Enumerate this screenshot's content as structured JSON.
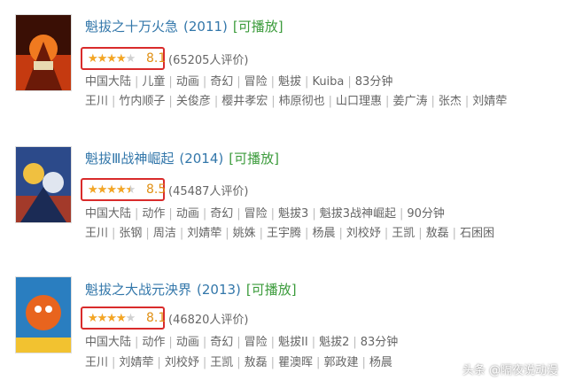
{
  "movies": [
    {
      "title": "魁拔之十万火急",
      "year": "(2011)",
      "playable": "[可播放]",
      "rating": 8.1,
      "score_text": "8.1",
      "stars_fraction": 0.8,
      "votes": "(65205人评价)",
      "tags": [
        "中国大陆",
        "儿童",
        "动画",
        "奇幻",
        "冒险",
        "魁拔",
        "Kuiba",
        "83分钟"
      ],
      "cast": [
        "王川",
        "竹内顺子",
        "关俊彦",
        "樱井孝宏",
        "柿原彻也",
        "山口理惠",
        "姜广涛",
        "张杰",
        "刘婧荦"
      ]
    },
    {
      "title": "魁拔Ⅲ战神崛起",
      "year": "(2014)",
      "playable": "[可播放]",
      "rating": 8.5,
      "score_text": "8.5",
      "stars_fraction": 0.9,
      "votes": "(45487人评价)",
      "tags": [
        "中国大陆",
        "动作",
        "动画",
        "奇幻",
        "冒险",
        "魁拔3",
        "魁拔3战神崛起",
        "90分钟"
      ],
      "cast": [
        "王川",
        "张钢",
        "周洁",
        "刘婧荦",
        "姚姝",
        "王宇腾",
        "杨晨",
        "刘校妤",
        "王凯",
        "敖磊",
        "石困困"
      ]
    },
    {
      "title": "魁拔之大战元泱界",
      "year": "(2013)",
      "playable": "[可播放]",
      "rating": 8.1,
      "score_text": "8.1",
      "stars_fraction": 0.8,
      "votes": "(46820人评价)",
      "tags": [
        "中国大陆",
        "动作",
        "动画",
        "奇幻",
        "冒险",
        "魁拔II",
        "魁拔2",
        "83分钟"
      ],
      "cast": [
        "王川",
        "刘婧荦",
        "刘校妤",
        "王凯",
        "敖磊",
        "瞿澳晖",
        "郭政建",
        "杨晨"
      ]
    }
  ],
  "watermark": "头条 @隔夜说动漫",
  "colors": {
    "link": "#3377aa",
    "playable": "#3b9b3b",
    "star": "#f5a623",
    "highlight_border": "#d92b2b"
  }
}
